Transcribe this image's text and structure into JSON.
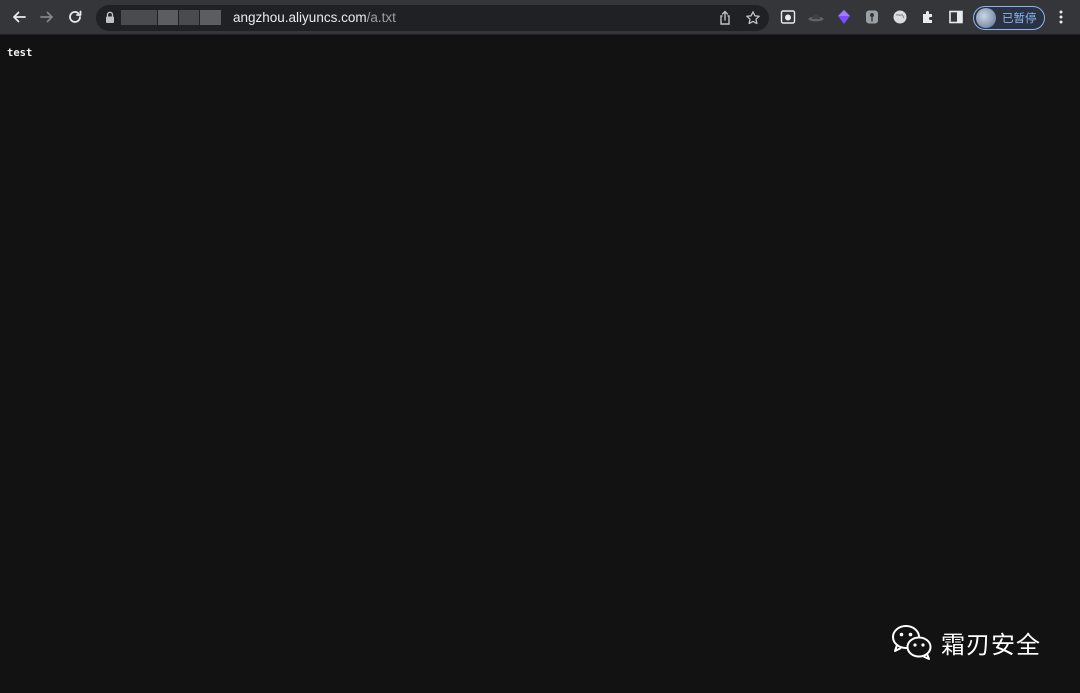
{
  "toolbar": {
    "url_host": "angzhou.aliyuncs.com",
    "url_path": "/a.txt",
    "profile_label": "已暂停"
  },
  "page": {
    "text": "test"
  },
  "watermark": {
    "text": "霜刃安全"
  }
}
